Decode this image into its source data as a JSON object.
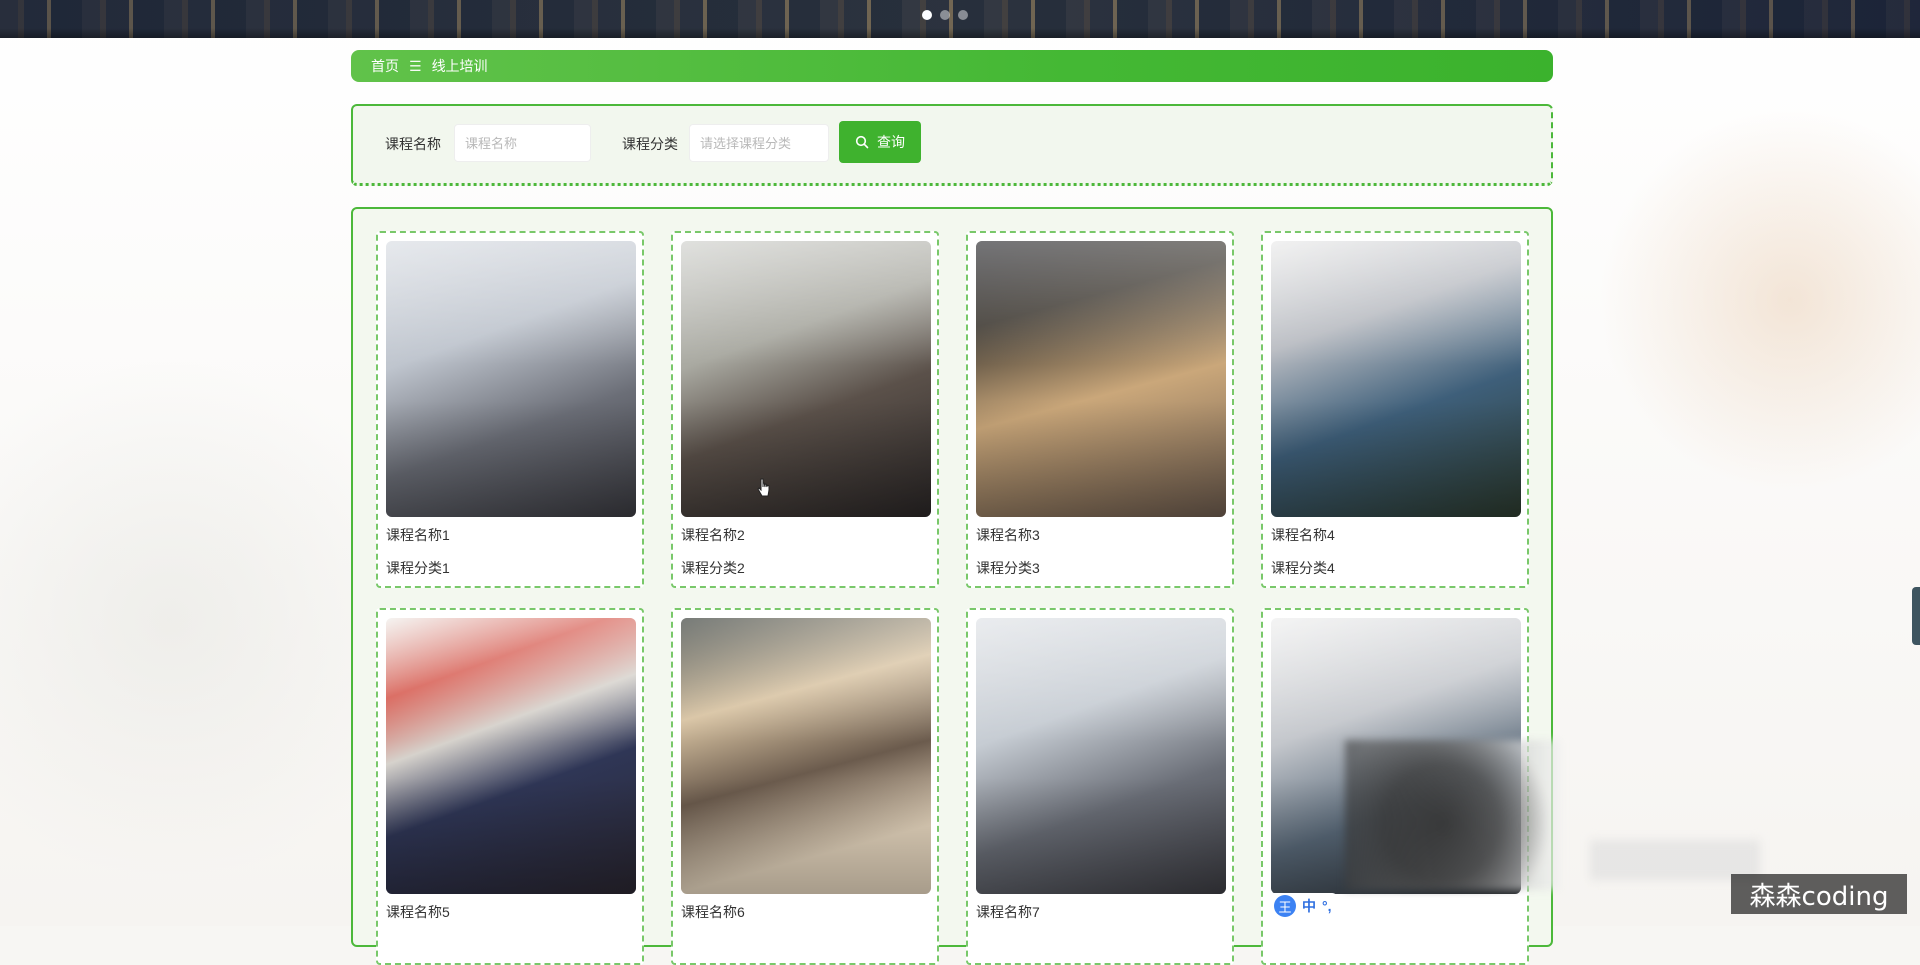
{
  "banner": {
    "dots": 3,
    "active_dot": 1
  },
  "breadcrumb": {
    "home": "首页",
    "separator": "☰",
    "current": "线上培训"
  },
  "search": {
    "course_name_label": "课程名称",
    "course_name_placeholder": "课程名称",
    "course_category_label": "课程分类",
    "course_category_placeholder": "请选择课程分类",
    "button_label": "查询"
  },
  "courses": [
    {
      "title": "课程名称1",
      "category": "课程分类1"
    },
    {
      "title": "课程名称2",
      "category": "课程分类2"
    },
    {
      "title": "课程名称3",
      "category": "课程分类3"
    },
    {
      "title": "课程名称4",
      "category": "课程分类4"
    },
    {
      "title": "课程名称5",
      "category": ""
    },
    {
      "title": "课程名称6",
      "category": ""
    },
    {
      "title": "课程名称7",
      "category": ""
    },
    {
      "title": "",
      "category": ""
    }
  ],
  "ime": {
    "badge": "王",
    "items": [
      "中",
      "°,"
    ]
  },
  "watermark": "森森coding",
  "colors": {
    "primary_green": "#3fb22e",
    "border_green": "#4cb83a"
  }
}
